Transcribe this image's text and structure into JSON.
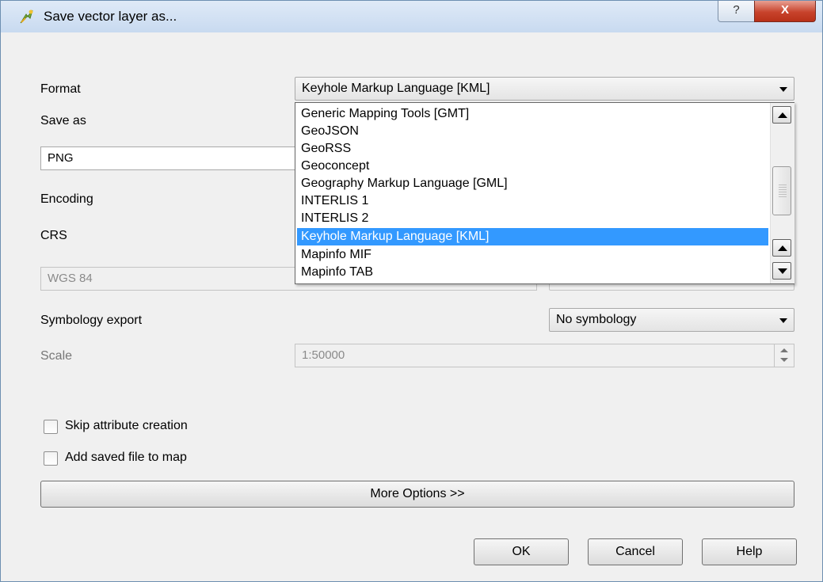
{
  "window": {
    "title": "Save vector layer as...",
    "help_glyph": "?",
    "close_glyph": "X"
  },
  "form": {
    "format_label": "Format",
    "format_value": "Keyhole Markup Language [KML]",
    "save_as_label": "Save as",
    "save_as_value": "PNG",
    "encoding_label": "Encoding",
    "crs_label": "CRS",
    "crs_value": "WGS 84",
    "symbology_label": "Symbology export",
    "symbology_value": "No symbology",
    "scale_label": "Scale",
    "scale_value": "1:50000",
    "skip_attr_label": "Skip attribute creation",
    "add_to_map_label": "Add saved file to map",
    "more_options_label": "More Options >>"
  },
  "dropdown": {
    "items": [
      "Generic Mapping Tools [GMT]",
      "GeoJSON",
      "GeoRSS",
      "Geoconcept",
      "Geography Markup Language [GML]",
      "INTERLIS 1",
      "INTERLIS 2",
      "Keyhole Markup Language [KML]",
      "Mapinfo MIF",
      "Mapinfo TAB"
    ],
    "selected": "Keyhole Markup Language [KML]"
  },
  "buttons": {
    "ok": "OK",
    "cancel": "Cancel",
    "help": "Help"
  },
  "icons": {
    "app": "qgis-icon",
    "help": "help-icon",
    "close": "close-icon"
  }
}
